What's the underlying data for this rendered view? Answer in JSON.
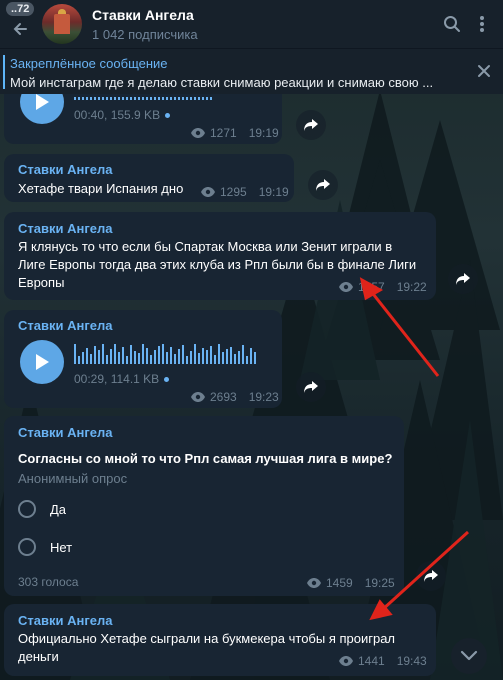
{
  "header": {
    "back_badge": "..72",
    "title": "Ставки Ангела",
    "subtitle": "1 042 подписчика",
    "search_icon": "search-icon",
    "more_icon": "more-vertical-icon"
  },
  "pinned": {
    "title": "Закреплённое сообщение",
    "text": "Мой инстаграм где я делаю ставки снимаю реакции и снимаю свою ...",
    "close_icon": "close-icon"
  },
  "messages": [
    {
      "type": "voice",
      "duration": "00:40, 155.9 KB",
      "views": "1271",
      "time": "19:19"
    },
    {
      "type": "text",
      "author": "Ставки Ангела",
      "text": "Хетафе твари Испания дно",
      "views": "1295",
      "time": "19:19"
    },
    {
      "type": "text",
      "author": "Ставки Ангела",
      "lines": [
        "Я клянусь то что если бы Спартак Москва или Зенит играли в",
        "Лиге Европы тогда два этих клуба из Рпл были бы в финале Лиги",
        "Европы"
      ],
      "views": "1557",
      "time": "19:22"
    },
    {
      "type": "voice",
      "author": "Ставки Ангела",
      "duration": "00:29, 114.1 KB",
      "views": "2693",
      "time": "19:23"
    },
    {
      "type": "poll",
      "author": "Ставки Ангела",
      "question": "Согласны со мной то что Рпл самая лучшая лига в мире?",
      "poll_type": "Анонимный опрос",
      "options": [
        "Да",
        "Нет"
      ],
      "votes": "303 голоса",
      "views": "1459",
      "time": "19:25"
    },
    {
      "type": "text",
      "author": "Ставки Ангела",
      "lines": [
        "Официально Хетафе сыграли на букмекера чтобы я проиграл",
        "деньги"
      ],
      "views": "1441",
      "time": "19:43"
    }
  ],
  "colors": {
    "accent": "#6ab3f3",
    "bubble": "#182533",
    "header": "#17212b",
    "annotation_arrow": "#e0241b"
  },
  "icons": {
    "share": "share-icon",
    "eye": "eye-icon",
    "play": "play-icon",
    "scroll_down": "chevron-down-icon",
    "back": "back-arrow-icon"
  }
}
